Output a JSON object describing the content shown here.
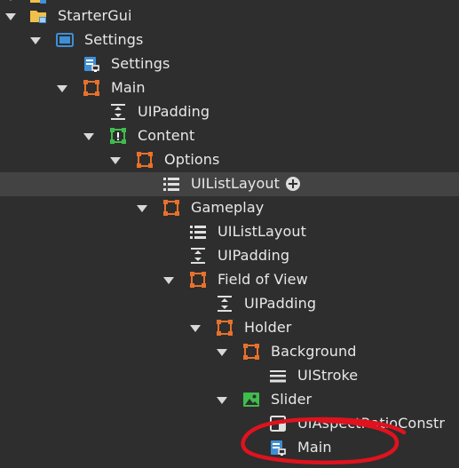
{
  "explorer": {
    "items": [
      {
        "label": "",
        "icon": "folder-icon"
      },
      {
        "label": "StarterGui",
        "icon": "folder-icon"
      },
      {
        "label": "Settings",
        "icon": "screengui-icon"
      },
      {
        "label": "Settings",
        "icon": "localscript-icon"
      },
      {
        "label": "Main",
        "icon": "frame-icon"
      },
      {
        "label": "UIPadding",
        "icon": "uipadding-icon"
      },
      {
        "label": "Content",
        "icon": "scrollingframe-icon"
      },
      {
        "label": "Options",
        "icon": "frame-icon"
      },
      {
        "label": "UIListLayout",
        "icon": "uilistlayout-icon"
      },
      {
        "label": "Gameplay",
        "icon": "frame-icon"
      },
      {
        "label": "UIListLayout",
        "icon": "uilistlayout-icon"
      },
      {
        "label": "UIPadding",
        "icon": "uipadding-icon"
      },
      {
        "label": "Field of View",
        "icon": "frame-icon"
      },
      {
        "label": "UIPadding",
        "icon": "uipadding-icon"
      },
      {
        "label": "Holder",
        "icon": "frame-icon"
      },
      {
        "label": "Background",
        "icon": "frame-icon"
      },
      {
        "label": "UIStroke",
        "icon": "uistroke-icon"
      },
      {
        "label": "Slider",
        "icon": "imagelabel-icon"
      },
      {
        "label": "UIAspectRatioConstr",
        "icon": "uiaspectratio-icon"
      },
      {
        "label": "Main",
        "icon": "localscript-icon"
      }
    ]
  },
  "colors": {
    "background": "#2e2e2e",
    "selected_row": "#434343",
    "text": "#e8e8e8",
    "frame_orange": "#e8712a",
    "scrolling_green": "#3fbd4c",
    "screengui_blue": "#3f8fd6",
    "annotation_red": "#e0121e"
  }
}
